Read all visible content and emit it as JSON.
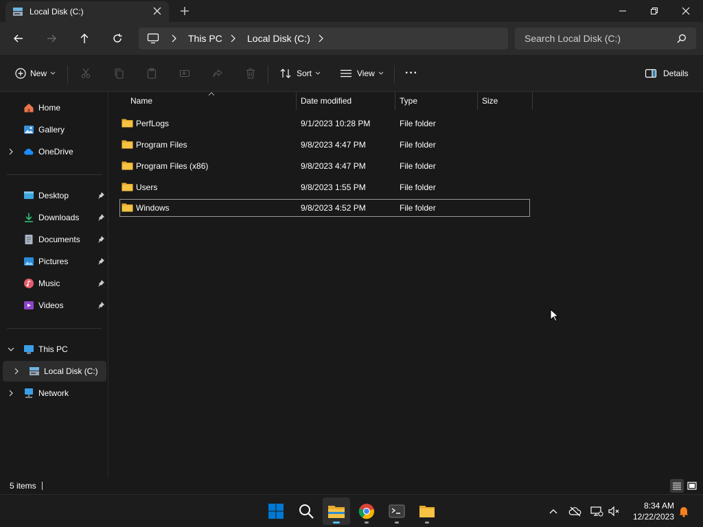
{
  "window": {
    "tab_title": "Local Disk (C:)",
    "new_tab_symbol": "+"
  },
  "nav": {
    "breadcrumbs": [
      "This PC",
      "Local Disk (C:)"
    ],
    "search_placeholder": "Search Local Disk (C:)"
  },
  "toolbar": {
    "new_label": "New",
    "sort_label": "Sort",
    "view_label": "View",
    "more_label": "···",
    "details_label": "Details"
  },
  "sidebar": {
    "quick": [
      {
        "label": "Home",
        "icon": "home-icon"
      },
      {
        "label": "Gallery",
        "icon": "gallery-icon"
      },
      {
        "label": "OneDrive",
        "icon": "onedrive-icon"
      }
    ],
    "pinned": [
      {
        "label": "Desktop",
        "icon": "desktop-icon"
      },
      {
        "label": "Downloads",
        "icon": "downloads-icon"
      },
      {
        "label": "Documents",
        "icon": "documents-icon"
      },
      {
        "label": "Pictures",
        "icon": "pictures-icon"
      },
      {
        "label": "Music",
        "icon": "music-icon"
      },
      {
        "label": "Videos",
        "icon": "videos-icon"
      }
    ],
    "tree": [
      {
        "label": "This PC",
        "icon": "pc-icon"
      },
      {
        "label": "Local Disk (C:)",
        "icon": "drive-icon"
      },
      {
        "label": "Network",
        "icon": "network-icon"
      }
    ]
  },
  "columns": {
    "name": "Name",
    "date": "Date modified",
    "type": "Type",
    "size": "Size"
  },
  "files": [
    {
      "name": "PerfLogs",
      "date": "9/1/2023 10:28 PM",
      "type": "File folder"
    },
    {
      "name": "Program Files",
      "date": "9/8/2023 4:47 PM",
      "type": "File folder"
    },
    {
      "name": "Program Files (x86)",
      "date": "9/8/2023 4:47 PM",
      "type": "File folder"
    },
    {
      "name": "Users",
      "date": "9/8/2023 1:55 PM",
      "type": "File folder"
    },
    {
      "name": "Windows",
      "date": "9/8/2023 4:52 PM",
      "type": "File folder"
    }
  ],
  "status": {
    "item_count": "5 items"
  },
  "taskbar": {
    "time": "8:34 AM",
    "date": "12/22/2023"
  },
  "colors": {
    "folder": "#f5c242",
    "accent": "#4cc2ff",
    "windows_blue": "#0078d4"
  }
}
